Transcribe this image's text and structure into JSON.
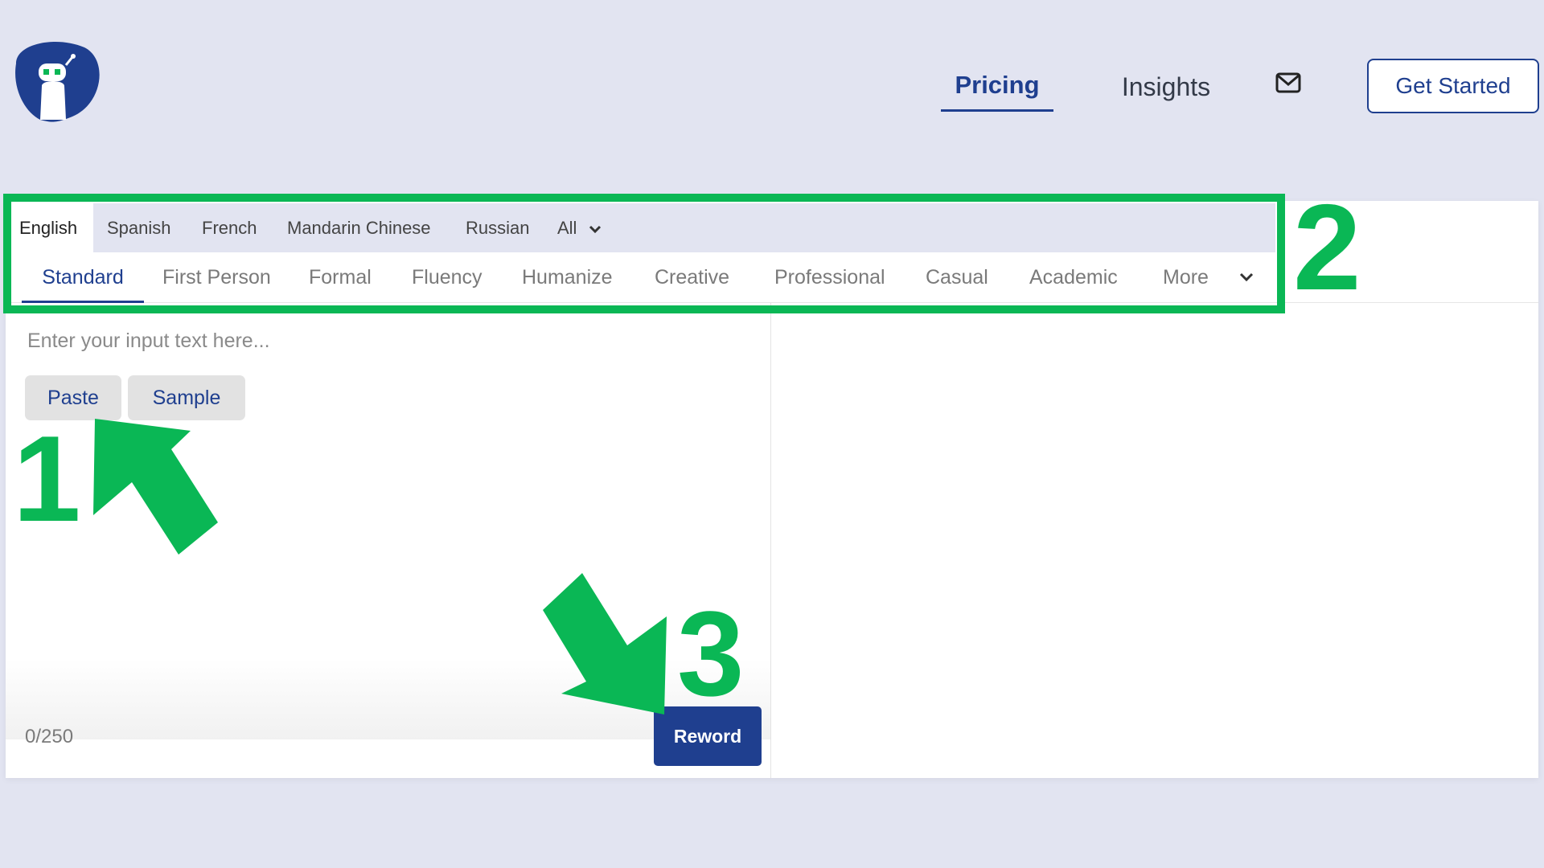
{
  "header": {
    "logo_icon": "robot-logo-icon",
    "nav": {
      "pricing": "Pricing",
      "insights": "Insights"
    },
    "mail_icon": "mail-icon",
    "get_started": "Get Started"
  },
  "languages": [
    "English",
    "Spanish",
    "French",
    "Mandarin Chinese",
    "Russian",
    "All"
  ],
  "active_language": "English",
  "modes": [
    "Standard",
    "First Person",
    "Formal",
    "Fluency",
    "Humanize",
    "Creative",
    "Professional",
    "Casual",
    "Academic",
    "More"
  ],
  "active_mode": "Standard",
  "input": {
    "placeholder": "Enter your input text here...",
    "paste": "Paste",
    "sample": "Sample",
    "count": "0/250",
    "reword": "Reword"
  },
  "annotations": {
    "one": "1",
    "two": "2",
    "three": "3"
  },
  "colors": {
    "accent": "#1f3f8f",
    "annotation": "#0ab755",
    "background": "#e2e4f1"
  }
}
